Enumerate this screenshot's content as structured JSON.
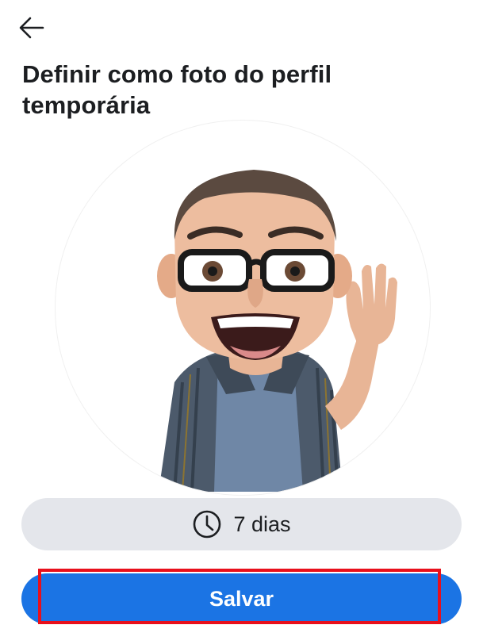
{
  "header": {
    "title": "Definir como foto do perfil temporária"
  },
  "duration": {
    "label": "7 dias",
    "icon": "clock-icon"
  },
  "actions": {
    "save_label": "Salvar"
  },
  "colors": {
    "accent": "#1b74e4",
    "pill_bg": "#e4e6eb",
    "highlight": "#e8101c",
    "text": "#1c1e21"
  }
}
